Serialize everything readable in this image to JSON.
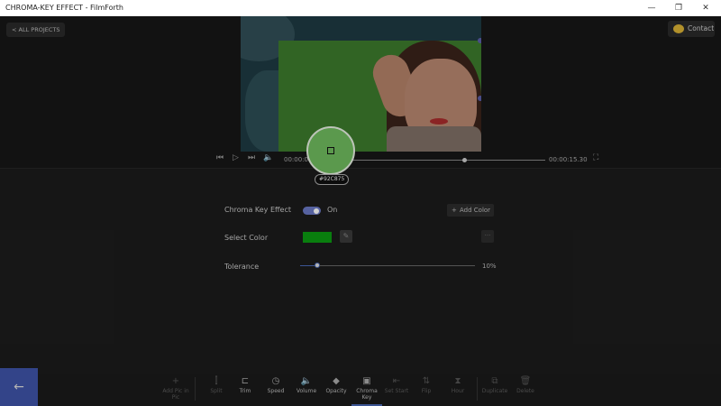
{
  "window": {
    "title": "CHROMA-KEY EFFECT - FilmForth",
    "minimize": "—",
    "maximize": "❐",
    "close": "✕"
  },
  "header": {
    "back_label": "< ALL PROJECTS",
    "contact_label": "Contact"
  },
  "player": {
    "current_time": "00:00:05",
    "end_time": "00:00:15.30",
    "progress_fraction": 0.61,
    "picked_color_hex": "#92C875",
    "icons": [
      "skip-back-icon",
      "play-icon",
      "skip-forward-icon",
      "volume-icon",
      "fullscreen-icon"
    ]
  },
  "chroma": {
    "effect_label": "Chroma Key Effect",
    "effect_state": "On",
    "add_color_label": "Add Color",
    "select_color_label": "Select Color",
    "selected_color": "#0b9a12",
    "tolerance_label": "Tolerance",
    "tolerance_value": "10%",
    "tolerance_fraction": 0.1
  },
  "toolbar": {
    "items": [
      {
        "label": "Add Pic in Pic",
        "icon": "plus-icon",
        "enabled": false
      },
      {
        "label": "Split",
        "icon": "split-icon",
        "enabled": false
      },
      {
        "label": "Trim",
        "icon": "trim-icon",
        "enabled": true
      },
      {
        "label": "Speed",
        "icon": "speed-icon",
        "enabled": true
      },
      {
        "label": "Volume",
        "icon": "volume-icon",
        "enabled": true
      },
      {
        "label": "Opacity",
        "icon": "opacity-icon",
        "enabled": true
      },
      {
        "label": "Chroma Key",
        "icon": "chroma-key-icon",
        "enabled": true,
        "active": true
      },
      {
        "label": "Set Start",
        "icon": "set-start-icon",
        "enabled": false
      },
      {
        "label": "Flip",
        "icon": "flip-icon",
        "enabled": false
      },
      {
        "label": "Hour",
        "icon": "hour-icon",
        "enabled": false
      },
      {
        "label": "Duplicate",
        "icon": "duplicate-icon",
        "enabled": false
      },
      {
        "label": "Delete",
        "icon": "delete-icon",
        "enabled": false
      }
    ]
  },
  "colors": {
    "accent": "#4a69b5",
    "key_green": "#3c7a2c"
  }
}
